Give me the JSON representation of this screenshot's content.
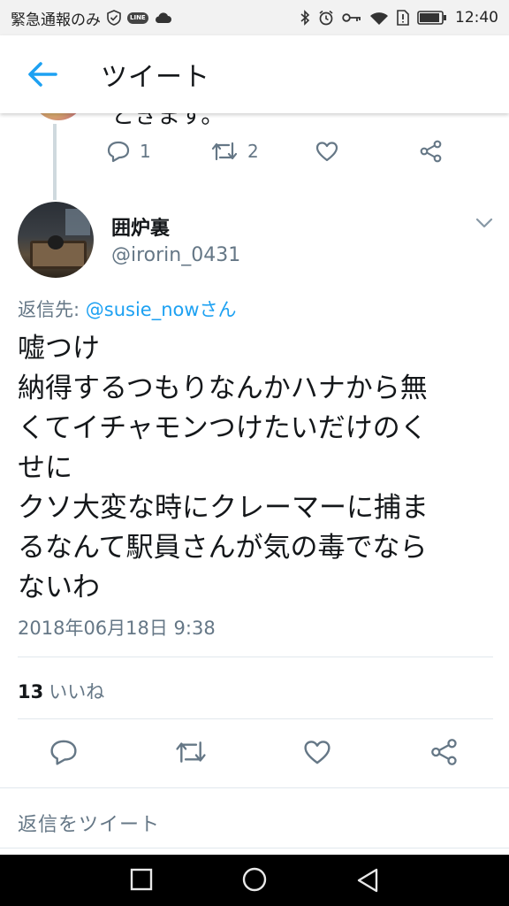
{
  "status_bar": {
    "left_text": "緊急通報のみ",
    "line_badge": "LINE",
    "time": "12:40",
    "icons": [
      "shield-icon",
      "line-icon",
      "cloud-icon",
      "bluetooth-icon",
      "alarm-icon",
      "key-icon",
      "wifi-icon",
      "sim-alert-icon",
      "battery-icon"
    ]
  },
  "appbar": {
    "title": "ツイート",
    "back_icon": "arrow-left-icon"
  },
  "previous_tweet": {
    "text": "ときます。",
    "reply_count": "1",
    "retweet_count": "2"
  },
  "tweet": {
    "author_name": "囲炉裏",
    "author_handle": "@irorin_0431",
    "reply_to_label": "返信先: ",
    "reply_to_mention": "@susie_nowさん",
    "body_lines": [
      "嘘つけ",
      "納得するつもりなんかハナから無",
      "くてイチャモンつけたいだけのく",
      "せに",
      "クソ大変な時にクレーマーに捕ま",
      "るなんて駅員さんが気の毒でなら",
      "ないわ"
    ],
    "timestamp": "2018年06月18日 9:38",
    "likes_count": "13",
    "likes_label": "いいね"
  },
  "reply_placeholder": "返信をツイート",
  "colors": {
    "accent": "#1da1f2",
    "muted": "#657786",
    "text": "#14171a"
  }
}
